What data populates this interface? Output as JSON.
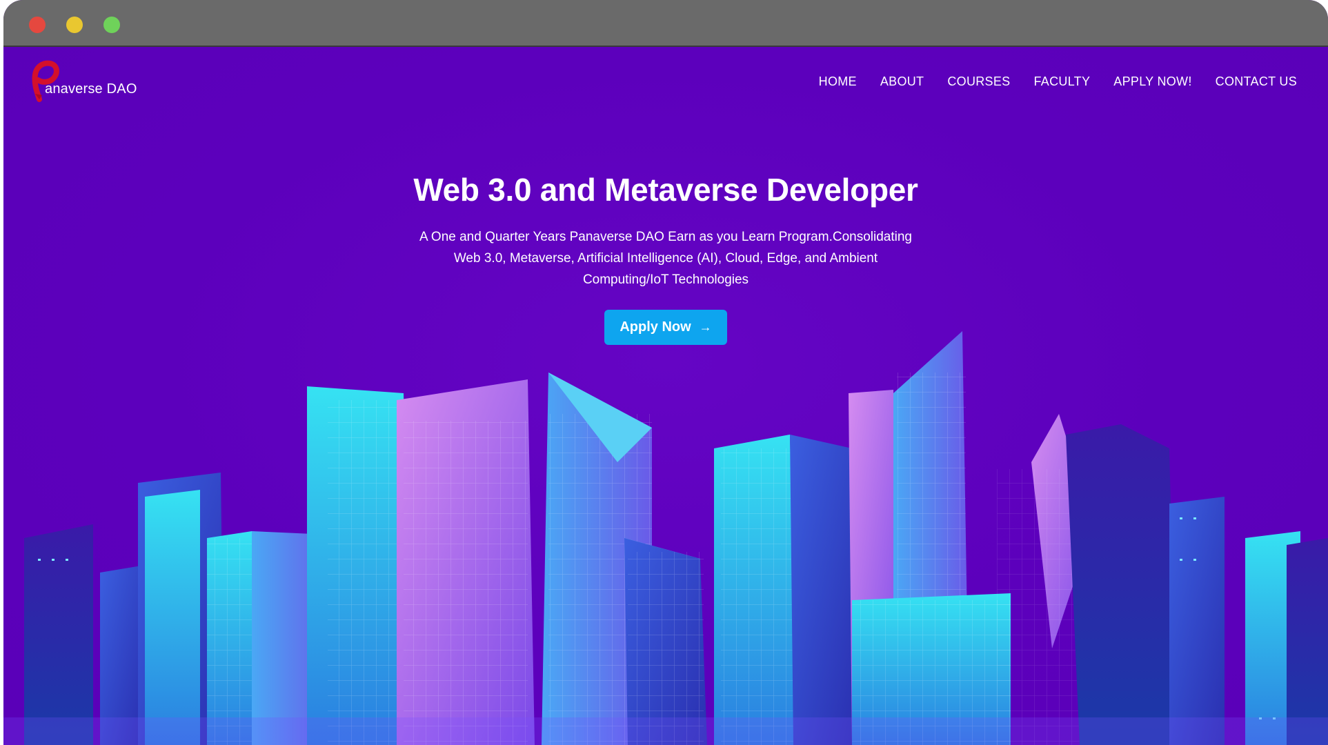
{
  "window": {
    "controls": [
      "close",
      "minimize",
      "zoom"
    ]
  },
  "brand": {
    "logo_initial": "P",
    "name": "anaverse DAO"
  },
  "nav": {
    "items": [
      {
        "label": "HOME"
      },
      {
        "label": "ABOUT"
      },
      {
        "label": "COURSES"
      },
      {
        "label": "FACULTY"
      },
      {
        "label": "APPLY NOW!"
      },
      {
        "label": "CONTACT US"
      }
    ]
  },
  "hero": {
    "title": "Web 3.0 and Metaverse Developer",
    "subtitle": "A One and Quarter Years Panaverse DAO Earn as you Learn Program.Consolidating Web 3.0, Metaverse, Artificial Intelligence (AI), Cloud, Edge, and Ambient Computing/IoT Technologies",
    "cta_label": "Apply Now",
    "cta_icon": "arrow-right-icon"
  },
  "colors": {
    "background": "#5f00bf",
    "cta": "#0ea5ef",
    "logo_red": "#d4102c",
    "text": "#ffffff"
  },
  "illustration": "city-skyline-illustration"
}
